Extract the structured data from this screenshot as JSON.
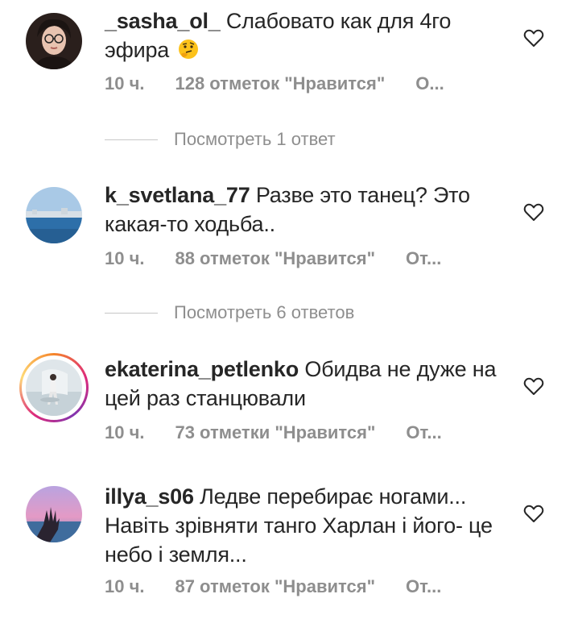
{
  "comments": [
    {
      "username": "_sasha_ol_",
      "text": "Слабовато как для 4го эфира",
      "emoji": "thinking-face-emoji",
      "time": "10 ч.",
      "likes": "128 отметок \"Нравится\"",
      "reply": "О...",
      "replies_label": "Посмотреть 1 ответ"
    },
    {
      "username": "k_svetlana_77",
      "text": "Разве это танец? Это какая-то ходьба..",
      "time": "10 ч.",
      "likes": "88 отметок \"Нравится\"",
      "reply": "От...",
      "replies_label": "Посмотреть 6 ответов"
    },
    {
      "username": "ekaterina_petlenko",
      "text": "Обидва не дуже на цей раз станцювали",
      "time": "10 ч.",
      "likes": "73 отметки \"Нравится\"",
      "reply": "От..."
    },
    {
      "username": "illya_s06",
      "text": "Ледве перебирає ногами... Навіть зрівняти танго Харлан і його- це небо і земля...",
      "time": "10 ч.",
      "likes": "87 отметок \"Нравится\"",
      "reply": "От..."
    }
  ],
  "icons": {
    "like": "heart-outline-icon"
  },
  "colors": {
    "muted": "#8e8e8e",
    "text": "#262626",
    "divider": "#c7c7c7"
  }
}
